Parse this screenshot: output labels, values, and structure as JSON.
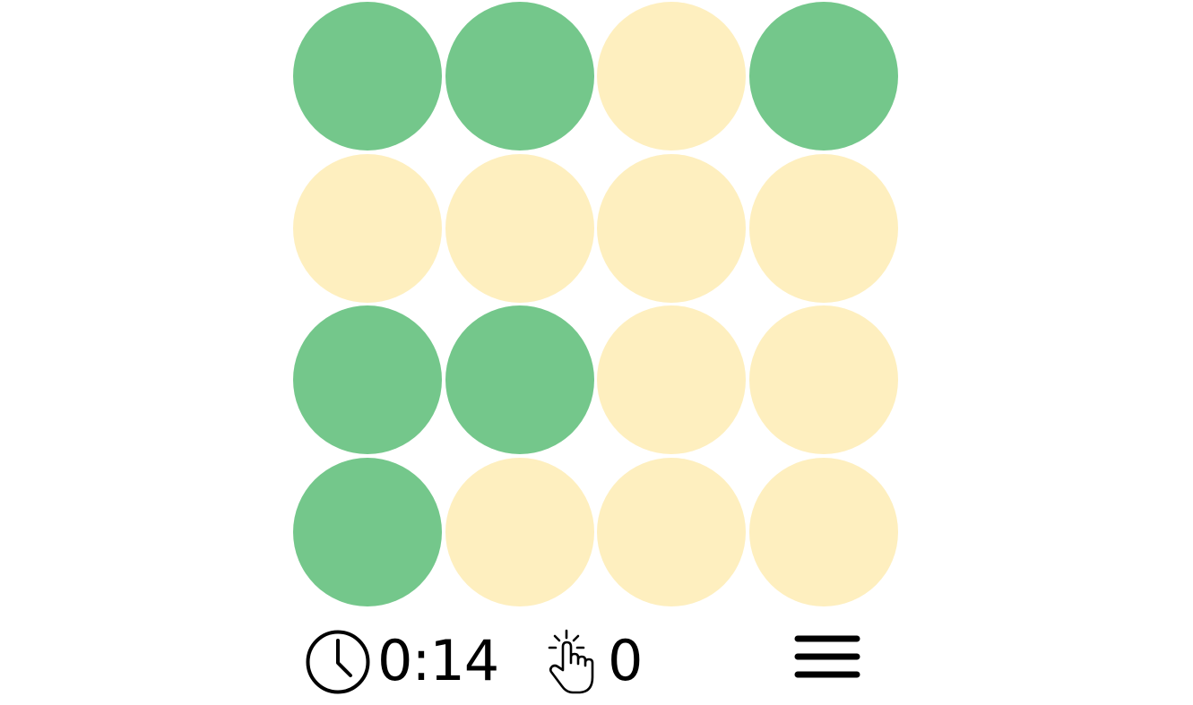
{
  "board": {
    "rows": 4,
    "cols": 4,
    "colors": {
      "on": "#74c78b",
      "off": "#feefbf"
    },
    "cells": [
      [
        "on",
        "on",
        "off",
        "on"
      ],
      [
        "off",
        "off",
        "off",
        "off"
      ],
      [
        "on",
        "on",
        "off",
        "off"
      ],
      [
        "on",
        "off",
        "off",
        "off"
      ]
    ]
  },
  "status": {
    "timer": "0:14",
    "timer_icon": "clock-icon",
    "moves": "0",
    "moves_icon": "tap-icon",
    "menu_icon": "hamburger-menu-icon"
  }
}
